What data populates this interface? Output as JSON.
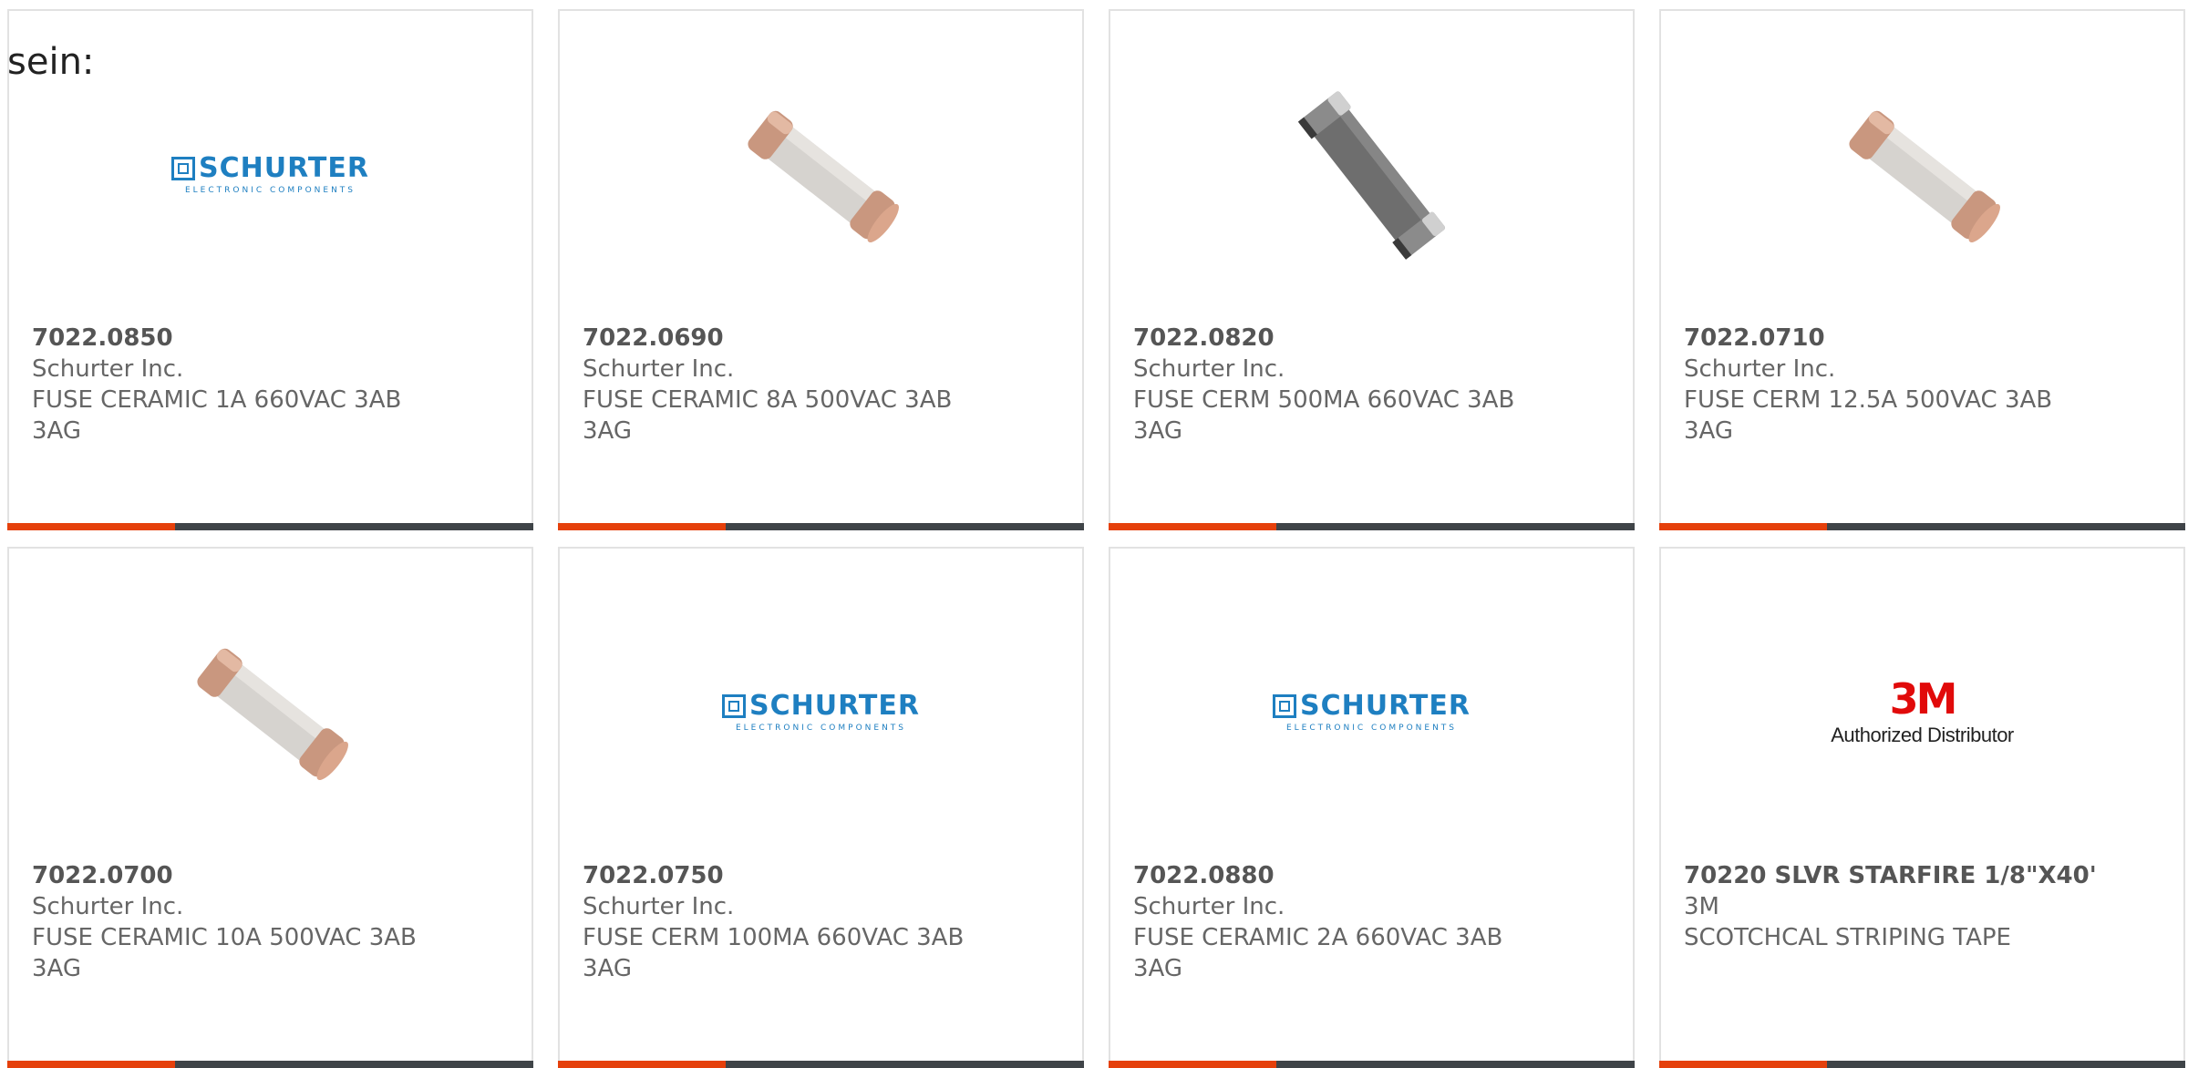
{
  "fragment_text": "sein:",
  "colors": {
    "accent": "#e5400b",
    "bar": "#3f4448",
    "schurter_blue": "#1e7fc1",
    "mmm_red": "#e10a0a"
  },
  "products": [
    {
      "part": "7022.0850",
      "maker": "Schurter Inc.",
      "desc1": "FUSE CERAMIC 1A 660VAC 3AB",
      "desc2": "3AG",
      "image": "schurter-logo"
    },
    {
      "part": "7022.0690",
      "maker": "Schurter Inc.",
      "desc1": "FUSE CERAMIC 8A 500VAC 3AB",
      "desc2": "3AG",
      "image": "fuse-ceramic-white"
    },
    {
      "part": "7022.0820",
      "maker": "Schurter Inc.",
      "desc1": "FUSE CERM 500MA 660VAC 3AB",
      "desc2": "3AG",
      "image": "fuse-ceramic-gray"
    },
    {
      "part": "7022.0710",
      "maker": "Schurter Inc.",
      "desc1": "FUSE CERM 12.5A 500VAC 3AB",
      "desc2": "3AG",
      "image": "fuse-ceramic-white"
    },
    {
      "part": "7022.0700",
      "maker": "Schurter Inc.",
      "desc1": "FUSE CERAMIC 10A 500VAC 3AB",
      "desc2": "3AG",
      "image": "fuse-ceramic-white"
    },
    {
      "part": "7022.0750",
      "maker": "Schurter Inc.",
      "desc1": "FUSE CERM 100MA 660VAC 3AB",
      "desc2": "3AG",
      "image": "schurter-logo"
    },
    {
      "part": "7022.0880",
      "maker": "Schurter Inc.",
      "desc1": "FUSE CERAMIC 2A 660VAC 3AB",
      "desc2": "3AG",
      "image": "schurter-logo"
    },
    {
      "part": "70220 SLVR STARFIRE 1/8\"X40'",
      "maker": "3M",
      "desc1": "SCOTCHCAL STRIPING TAPE",
      "desc2": "",
      "image": "3m-logo"
    }
  ],
  "logos": {
    "schurter_name": "SCHURTER",
    "schurter_tagline": "ELECTRONIC COMPONENTS",
    "mmm_name": "3M",
    "mmm_tagline": "Authorized Distributor"
  }
}
